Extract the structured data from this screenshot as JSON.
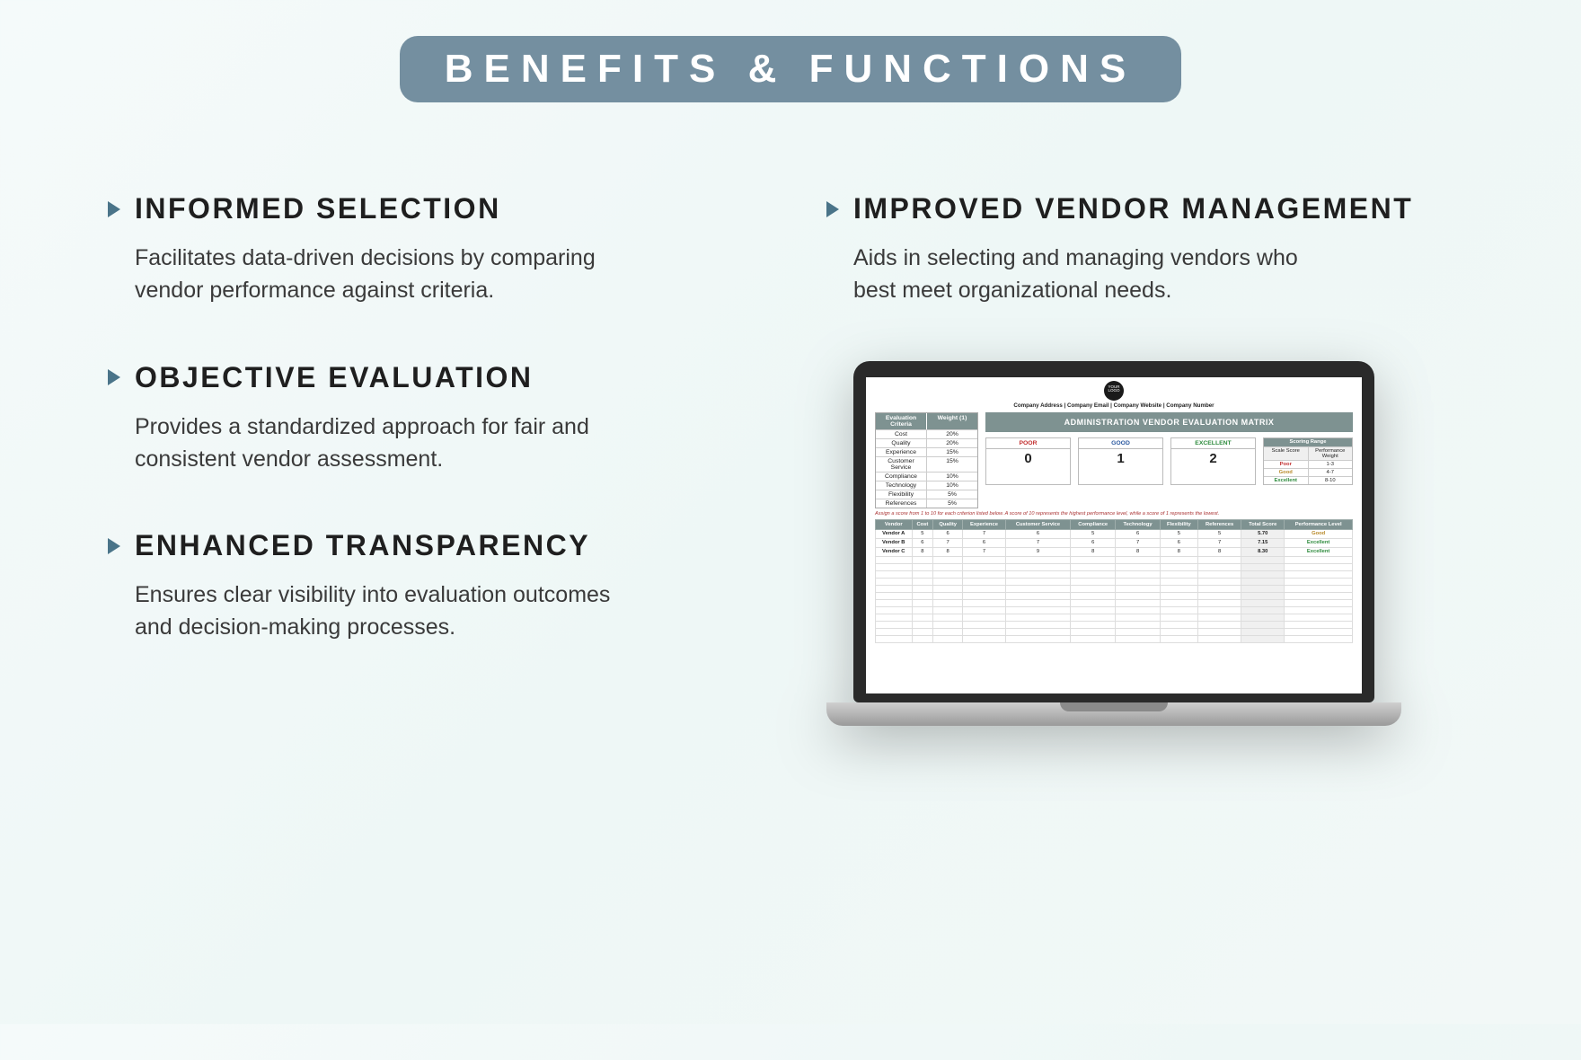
{
  "page_title": "BENEFITS & FUNCTIONS",
  "benefits": [
    {
      "title": "INFORMED SELECTION",
      "body": "Facilitates data-driven decisions by comparing vendor performance against criteria."
    },
    {
      "title": "OBJECTIVE EVALUATION",
      "body": "Provides a standardized approach for fair and consistent vendor assessment."
    },
    {
      "title": "ENHANCED TRANSPARENCY",
      "body": "Ensures clear visibility into evaluation outcomes and decision-making processes."
    },
    {
      "title": "IMPROVED VENDOR MANAGEMENT",
      "body": "Aids in selecting and managing vendors who best meet organizational needs."
    }
  ],
  "mockup": {
    "logo_text": "YOUR LOGO",
    "company_line": "Company Address  |  Company Email  |  Company Website  |  Company Number",
    "criteria_header": [
      "Evaluation Criteria",
      "Weight (1)"
    ],
    "criteria": [
      {
        "name": "Cost",
        "weight": "20%"
      },
      {
        "name": "Quality",
        "weight": "20%"
      },
      {
        "name": "Experience",
        "weight": "15%"
      },
      {
        "name": "Customer Service",
        "weight": "15%"
      },
      {
        "name": "Compliance",
        "weight": "10%"
      },
      {
        "name": "Technology",
        "weight": "10%"
      },
      {
        "name": "Flexibility",
        "weight": "5%"
      },
      {
        "name": "References",
        "weight": "5%"
      }
    ],
    "matrix_title": "ADMINISTRATION VENDOR EVALUATION MATRIX",
    "legend": {
      "poor": {
        "label": "POOR",
        "value": "0"
      },
      "good": {
        "label": "GOOD",
        "value": "1"
      },
      "exc": {
        "label": "EXCELLENT",
        "value": "2"
      }
    },
    "range": {
      "title": "Scoring Range",
      "head": [
        "Scale Score",
        "Performance Weight"
      ],
      "rows": [
        {
          "label": "Poor",
          "val": "1-3",
          "cls": "poor-c"
        },
        {
          "label": "Good",
          "val": "4-7",
          "cls": "gold-c"
        },
        {
          "label": "Excellent",
          "val": "8-10",
          "cls": "exc-c"
        }
      ]
    },
    "instruction": "Assign a score from 1 to 10 for each criterion listed below. A score of 10 represents the highest performance level, while a score of 1 represents the lowest.",
    "vendor_head": [
      "Vendor",
      "Cost",
      "Quality",
      "Experience",
      "Customer Service",
      "Compliance",
      "Technology",
      "Flexibility",
      "References",
      "Total Score",
      "Performance Level"
    ],
    "vendors": [
      {
        "name": "Vendor A",
        "vals": [
          "5",
          "6",
          "7",
          "6",
          "5",
          "6",
          "5",
          "5"
        ],
        "total": "5.70",
        "perf": "Good",
        "perf_cls": "gold-c"
      },
      {
        "name": "Vendor B",
        "vals": [
          "6",
          "7",
          "6",
          "7",
          "6",
          "7",
          "6",
          "7"
        ],
        "total": "7.15",
        "perf": "Excellent",
        "perf_cls": "exc-c"
      },
      {
        "name": "Vendor C",
        "vals": [
          "8",
          "8",
          "7",
          "9",
          "8",
          "8",
          "8",
          "8"
        ],
        "total": "8.30",
        "perf": "Excellent",
        "perf_cls": "exc-c"
      }
    ]
  }
}
